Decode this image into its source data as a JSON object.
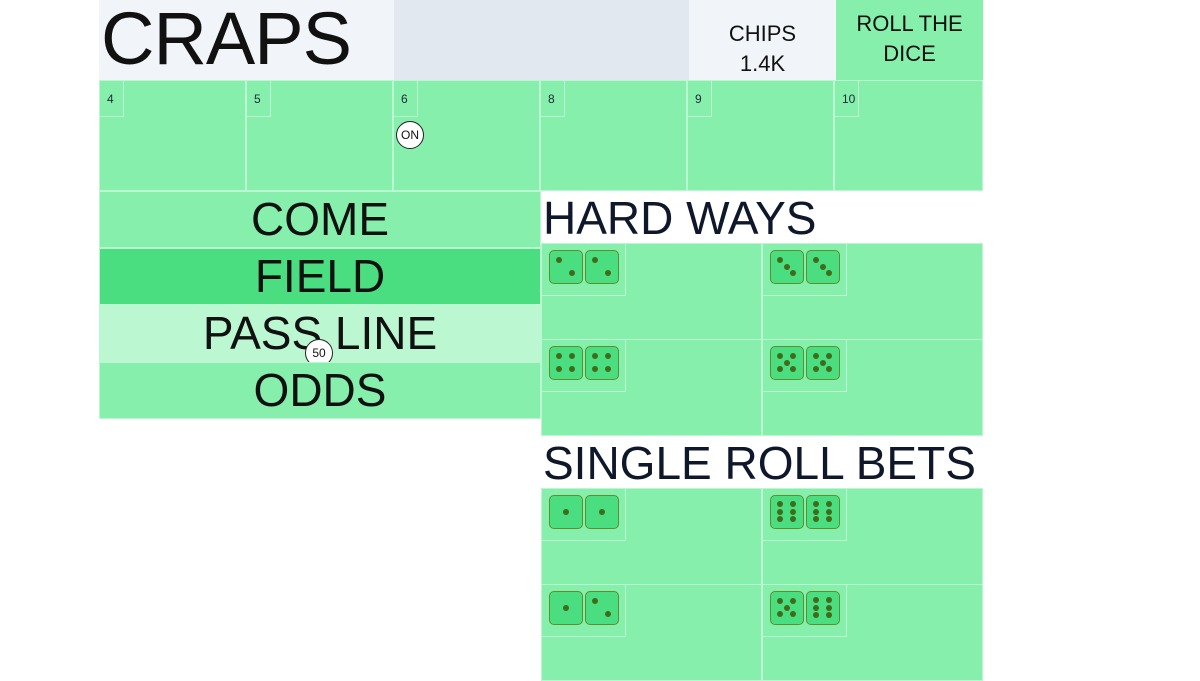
{
  "header": {
    "title": "CRAPS",
    "chips_label": "CHIPS",
    "chips_value": "1.4K",
    "roll_button": "ROLL THE DICE"
  },
  "points": [
    {
      "label": "4"
    },
    {
      "label": "5"
    },
    {
      "label": "6",
      "puck": "ON"
    },
    {
      "label": "8"
    },
    {
      "label": "9"
    },
    {
      "label": "10"
    }
  ],
  "line_bets": {
    "come": "COME",
    "field": "FIELD",
    "pass_line": "PASS LINE",
    "pass_line_chip": "50",
    "odds": "ODDS"
  },
  "hard_ways": {
    "title": "HARD WAYS",
    "bets": [
      {
        "dice": [
          2,
          2
        ]
      },
      {
        "dice": [
          3,
          3
        ]
      },
      {
        "dice": [
          4,
          4
        ]
      },
      {
        "dice": [
          5,
          5
        ]
      }
    ]
  },
  "single_roll": {
    "title": "SINGLE ROLL BETS",
    "bets": [
      {
        "dice": [
          1,
          1
        ]
      },
      {
        "dice": [
          6,
          6
        ]
      },
      {
        "dice": [
          1,
          2
        ]
      },
      {
        "dice": [
          5,
          6
        ]
      }
    ]
  },
  "colors": {
    "felt": "#86efac",
    "field_highlight": "#4ade80",
    "pass_line_highlight": "#bbf7d0",
    "die_fill": "#4ade80",
    "pip": "#416b1a"
  }
}
